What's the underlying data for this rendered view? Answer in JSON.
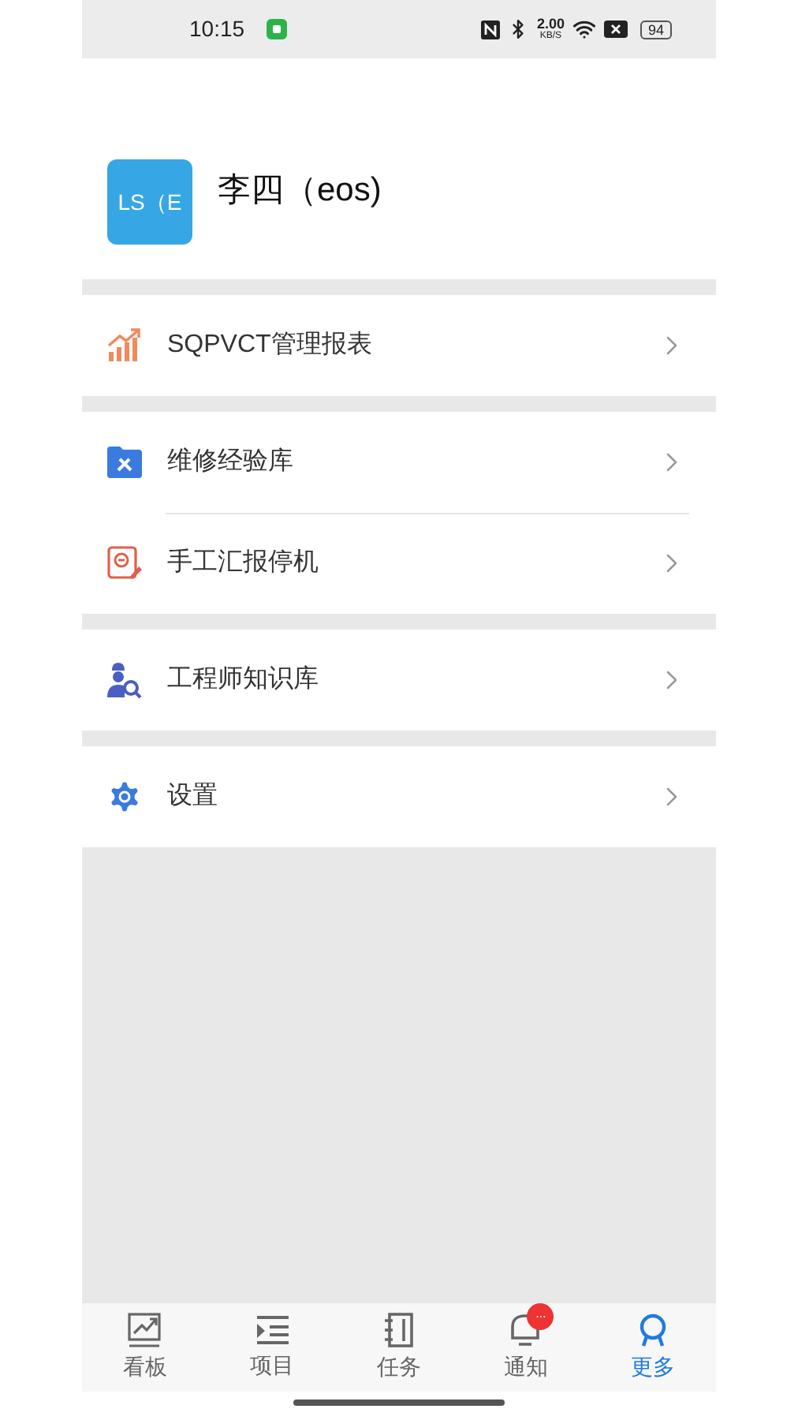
{
  "status_bar": {
    "time": "10:15",
    "speed": "2.00",
    "speed_unit": "KB/S",
    "battery": "94"
  },
  "profile": {
    "avatar_text": "LS（E",
    "name": "李四（eos)"
  },
  "sections": [
    {
      "items": [
        {
          "kind": "chart",
          "label": "SQPVCT管理报表"
        }
      ]
    },
    {
      "items": [
        {
          "kind": "repair",
          "label": "维修经验库"
        },
        {
          "kind": "report",
          "label": "手工汇报停机"
        }
      ]
    },
    {
      "items": [
        {
          "kind": "engineer",
          "label": "工程师知识库"
        }
      ]
    },
    {
      "items": [
        {
          "kind": "settings",
          "label": "设置"
        }
      ]
    }
  ],
  "tabs": [
    {
      "kind": "board",
      "label": "看板",
      "selected": false
    },
    {
      "kind": "project",
      "label": "项目",
      "selected": false
    },
    {
      "kind": "task",
      "label": "任务",
      "selected": false
    },
    {
      "kind": "notice",
      "label": "通知",
      "selected": false,
      "badge": "..."
    },
    {
      "kind": "more",
      "label": "更多",
      "selected": true
    }
  ]
}
